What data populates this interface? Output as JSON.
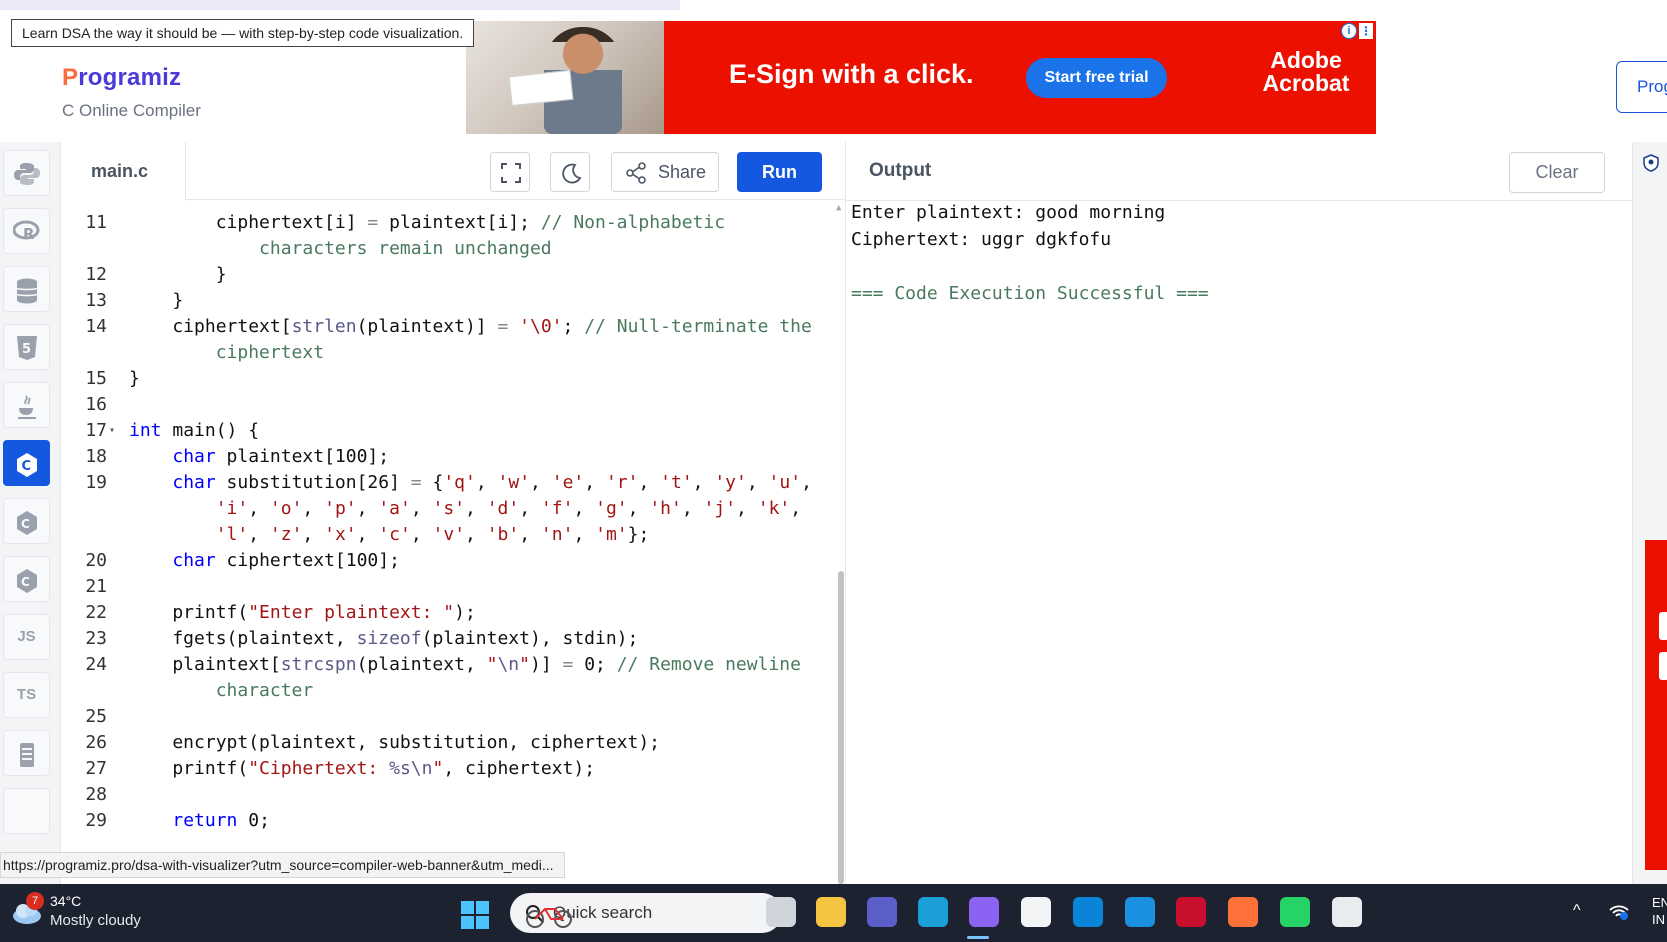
{
  "header": {
    "tooltip": "Learn DSA the way it should be — with step-by-step code visualization.",
    "logo_first": "P",
    "logo_rest": "rogramiz",
    "compiler_name": "C Online Compiler",
    "pro_button_label": "Prog"
  },
  "ad": {
    "headline": "E-Sign with a click.",
    "cta": "Start free trial",
    "brand_line1": "Adobe",
    "brand_line2": "Acrobat",
    "info_icon": "info-icon",
    "menu_icon": "more-vert-icon"
  },
  "sidebar": {
    "items": [
      {
        "name": "python",
        "label": "",
        "icon": "python-icon",
        "active": false
      },
      {
        "name": "r",
        "label": "R",
        "icon": "r-icon",
        "active": false
      },
      {
        "name": "sql",
        "label": "",
        "icon": "database-icon",
        "active": false
      },
      {
        "name": "html",
        "label": "5",
        "icon": "html5-icon",
        "active": false
      },
      {
        "name": "java",
        "label": "",
        "icon": "java-icon",
        "active": false
      },
      {
        "name": "c",
        "label": "C",
        "icon": "c-icon",
        "active": true
      },
      {
        "name": "csharp",
        "label": "C",
        "icon": "csharp-icon",
        "active": false
      },
      {
        "name": "cpp",
        "label": "C",
        "icon": "cpp-icon",
        "active": false
      },
      {
        "name": "js",
        "label": "JS",
        "icon": "js-icon",
        "active": false
      },
      {
        "name": "ts",
        "label": "TS",
        "icon": "ts-icon",
        "active": false
      },
      {
        "name": "go",
        "label": "≡",
        "icon": "go-icon",
        "active": false
      },
      {
        "name": "more",
        "label": "",
        "icon": "more-icon",
        "active": false
      }
    ]
  },
  "editor": {
    "file_name": "main.c",
    "share_label": "Share",
    "run_label": "Run",
    "lines": [
      {
        "n": "11",
        "fold": "",
        "html": "        ciphertext[i] <span class=\"op\">=</span> plaintext[i]; <span class=\"cm\">// Non-alphabetic</span>"
      },
      {
        "n": "",
        "fold": "",
        "html": "            <span class=\"cm\">characters remain unchanged</span>"
      },
      {
        "n": "12",
        "fold": "",
        "html": "        }"
      },
      {
        "n": "13",
        "fold": "",
        "html": "    }"
      },
      {
        "n": "14",
        "fold": "",
        "html": "    ciphertext[<span class=\"fn\">strlen</span>(plaintext)] <span class=\"op\">=</span> <span class=\"st\">'\\0'</span>; <span class=\"cm\">// Null-terminate the</span>"
      },
      {
        "n": "",
        "fold": "",
        "html": "        <span class=\"cm\">ciphertext</span>"
      },
      {
        "n": "15",
        "fold": "",
        "html": "}"
      },
      {
        "n": "16",
        "fold": "",
        "html": ""
      },
      {
        "n": "17",
        "fold": "▾",
        "html": "<span class=\"kw\">int</span> main() {"
      },
      {
        "n": "18",
        "fold": "",
        "html": "    <span class=\"kw\">char</span> plaintext[100];"
      },
      {
        "n": "19",
        "fold": "",
        "html": "    <span class=\"kw\">char</span> substitution[26] <span class=\"op\">=</span> {<span class=\"st\">'q'</span>, <span class=\"st\">'w'</span>, <span class=\"st\">'e'</span>, <span class=\"st\">'r'</span>, <span class=\"st\">'t'</span>, <span class=\"st\">'y'</span>, <span class=\"st\">'u'</span>,"
      },
      {
        "n": "",
        "fold": "",
        "html": "        <span class=\"st\">'i'</span>, <span class=\"st\">'o'</span>, <span class=\"st\">'p'</span>, <span class=\"st\">'a'</span>, <span class=\"st\">'s'</span>, <span class=\"st\">'d'</span>, <span class=\"st\">'f'</span>, <span class=\"st\">'g'</span>, <span class=\"st\">'h'</span>, <span class=\"st\">'j'</span>, <span class=\"st\">'k'</span>,"
      },
      {
        "n": "",
        "fold": "",
        "html": "        <span class=\"st\">'l'</span>, <span class=\"st\">'z'</span>, <span class=\"st\">'x'</span>, <span class=\"st\">'c'</span>, <span class=\"st\">'v'</span>, <span class=\"st\">'b'</span>, <span class=\"st\">'n'</span>, <span class=\"st\">'m'</span>};"
      },
      {
        "n": "20",
        "fold": "",
        "html": "    <span class=\"kw\">char</span> ciphertext[100];"
      },
      {
        "n": "21",
        "fold": "",
        "html": ""
      },
      {
        "n": "22",
        "fold": "",
        "html": "    printf(<span class=\"st\">\"Enter plaintext: \"</span>);"
      },
      {
        "n": "23",
        "fold": "",
        "html": "    fgets(plaintext, <span class=\"fn\">sizeof</span>(plaintext), stdin);"
      },
      {
        "n": "24",
        "fold": "",
        "html": "    plaintext[<span class=\"fn\">strcspn</span>(plaintext, <span class=\"st\">\"</span><span class=\"fn\">\\n</span><span class=\"st\">\"</span>)] <span class=\"op\">=</span> 0; <span class=\"cm\">// Remove newline</span>"
      },
      {
        "n": "",
        "fold": "",
        "html": "        <span class=\"cm\">character</span>"
      },
      {
        "n": "25",
        "fold": "",
        "html": ""
      },
      {
        "n": "26",
        "fold": "",
        "html": "    encrypt(plaintext, substitution, ciphertext);"
      },
      {
        "n": "27",
        "fold": "",
        "html": "    printf(<span class=\"st\">\"Ciphertext: </span><span class=\"fn\">%s\\n</span><span class=\"st\">\"</span>, ciphertext);"
      },
      {
        "n": "28",
        "fold": "",
        "html": ""
      },
      {
        "n": "29",
        "fold": "",
        "html": "    <span class=\"kw\">return</span> 0;"
      }
    ]
  },
  "output": {
    "title": "Output",
    "clear_label": "Clear",
    "line1": "Enter plaintext: good morning",
    "line2": "Ciphertext: uggr dgkfofu",
    "success": "=== Code Execution Successful ==="
  },
  "status_url": "https://programiz.pro/dsa-with-visualizer?utm_source=compiler-web-banner&utm_medi...",
  "taskbar": {
    "weather_badge": "7",
    "temperature": "34°C",
    "weather_desc": "Mostly cloudy",
    "search_label": "Quick search",
    "language": "EN",
    "language2": "IN",
    "apps": [
      {
        "name": "task-view-icon",
        "color": "#d0d4db"
      },
      {
        "name": "file-explorer-icon",
        "color": "#f5c542"
      },
      {
        "name": "teams-icon",
        "color": "#5b5fc7"
      },
      {
        "name": "edge-icon",
        "color": "#1a9fd8"
      },
      {
        "name": "copilot-icon",
        "color": "#8a63f2"
      },
      {
        "name": "store-icon",
        "color": "#f3f4f6"
      },
      {
        "name": "myhp-icon",
        "color": "#0a84d6"
      },
      {
        "name": "help-icon",
        "color": "#1b8fe0"
      },
      {
        "name": "mcafee-icon",
        "color": "#c8102e"
      },
      {
        "name": "firefox-icon",
        "color": "#ff7139"
      },
      {
        "name": "whatsapp-icon",
        "color": "#25d366"
      },
      {
        "name": "chrome-icon",
        "color": "#e9ecef"
      }
    ]
  }
}
